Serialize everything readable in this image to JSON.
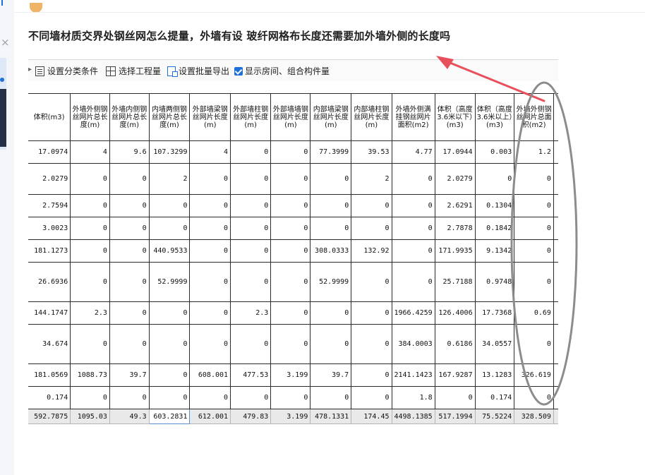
{
  "question": {
    "title": "不同墙材质交界处钢丝网怎么提量，外墙有设 玻纤网格布长度还需要加外墙外侧的长度吗"
  },
  "toolbar": {
    "items": [
      {
        "icon": "filter-list-icon",
        "label": "设置分类条件"
      },
      {
        "icon": "table-select-icon",
        "label": "选择工程量"
      },
      {
        "icon": "export-icon",
        "label": "设置批量导出"
      },
      {
        "icon": "checkbox-checked-icon",
        "label": "显示房间、组合构件量",
        "checked": true
      }
    ]
  },
  "table": {
    "columns": [
      "体积(m3)",
      "外墙外侧钢丝网片总长度(m)",
      "外墙内侧钢丝网片总长度(m)",
      "内墙两侧钢丝网片总长度(m)",
      "外部墙梁钢丝网片长度(m)",
      "外部墙柱钢丝网片长度(m)",
      "外部墙墙钢丝网片长度(m)",
      "内部墙梁钢丝网片长度(m)",
      "内部墙柱钢丝网片长度(m)",
      "外墙外侧满挂钢丝网片面积(m2)",
      "体积（高度3.6米以下）(m3)",
      "体积（高度3.6米以上）(m3)",
      "外墙外侧钢丝网片总面积(m2)"
    ],
    "rows": [
      [
        "17.0974",
        "4",
        "9.6",
        "107.3299",
        "4",
        "0",
        "0",
        "77.3999",
        "39.53",
        "4.77",
        "17.0944",
        "0.003",
        "1.2"
      ],
      [
        "2.0279",
        "0",
        "0",
        "2",
        "0",
        "0",
        "0",
        "0",
        "2",
        "0",
        "2.0279",
        "0",
        "0"
      ],
      [
        "2.7594",
        "0",
        "0",
        "0",
        "0",
        "0",
        "0",
        "0",
        "0",
        "0",
        "2.6291",
        "0.1304",
        "0"
      ],
      [
        "3.0023",
        "0",
        "0",
        "0",
        "0",
        "0",
        "0",
        "0",
        "0",
        "0",
        "2.7878",
        "0.1842",
        "0"
      ],
      [
        "181.1273",
        "0",
        "0",
        "440.9533",
        "0",
        "0",
        "0",
        "308.0333",
        "132.92",
        "0",
        "171.9935",
        "9.1342",
        "0"
      ],
      [
        "26.6936",
        "0",
        "0",
        "52.9999",
        "0",
        "0",
        "0",
        "52.9999",
        "0",
        "0",
        "25.7188",
        "0.9748",
        "0"
      ],
      [
        "144.1747",
        "2.3",
        "0",
        "0",
        "0",
        "2.3",
        "0",
        "0",
        "0",
        "1966.4259",
        "126.4006",
        "17.7368",
        "0.69"
      ],
      [
        "34.674",
        "0",
        "0",
        "0",
        "0",
        "0",
        "0",
        "0",
        "0",
        "384.0003",
        "0.6186",
        "34.0557",
        "0"
      ],
      [
        "181.0569",
        "1088.73",
        "39.7",
        "0",
        "608.001",
        "477.53",
        "3.199",
        "39.7",
        "0",
        "2141.1423",
        "167.9287",
        "13.1283",
        "326.619"
      ],
      [
        "0.174",
        "0",
        "0",
        "0",
        "0",
        "0",
        "0",
        "0",
        "0",
        "1.8",
        "0",
        "0.174",
        "0"
      ]
    ],
    "total": [
      "592.7875",
      "1095.03",
      "49.3",
      "603.2831",
      "612.001",
      "479.83",
      "3.199",
      "478.1331",
      "174.45",
      "4498.1385",
      "517.1994",
      "75.5224",
      "328.509"
    ],
    "selected_total_column": 3
  },
  "annotations": {
    "arrow_color": "#e8505b",
    "ellipse_color": "#8c8c8c"
  }
}
